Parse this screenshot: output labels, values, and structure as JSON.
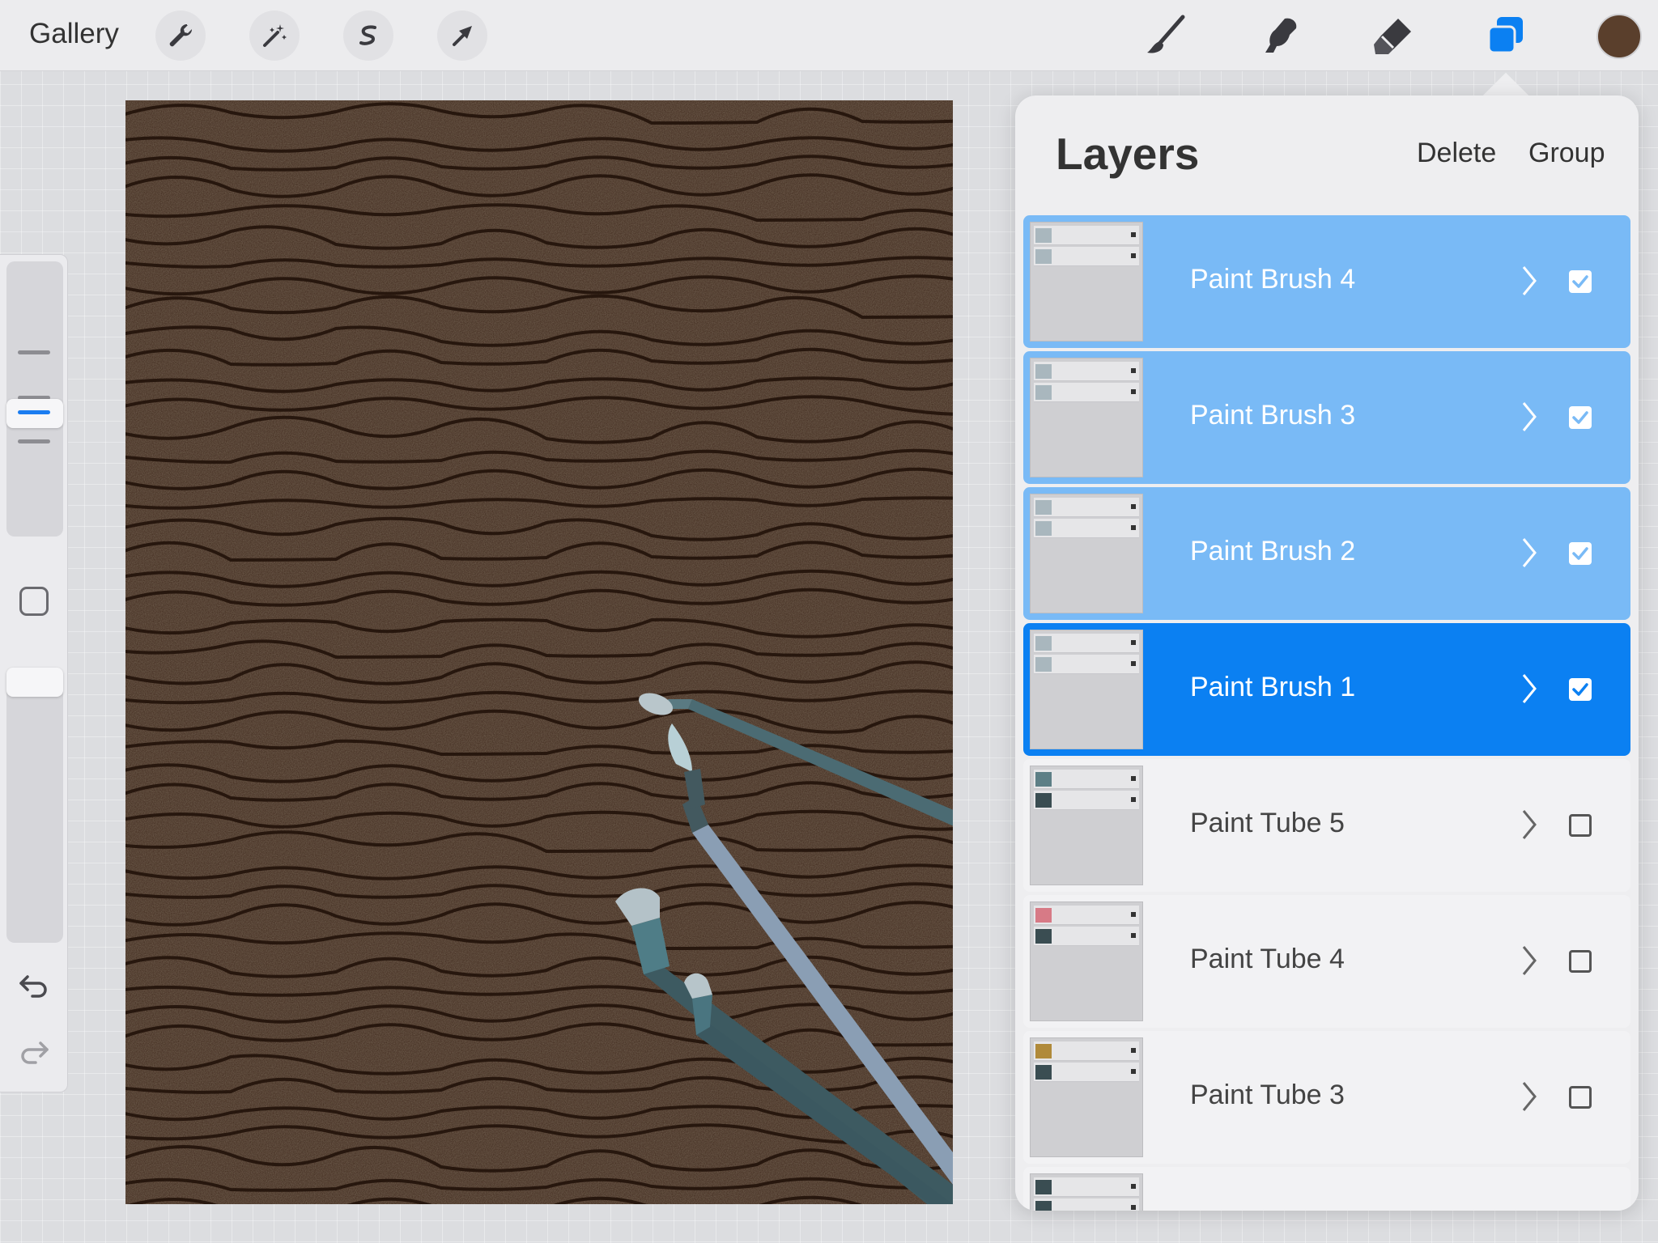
{
  "topbar": {
    "gallery_label": "Gallery",
    "tools": [
      "wrench-icon",
      "magic-wand-icon",
      "selection-icon",
      "transform-arrow-icon"
    ],
    "right_tools": [
      "brush-icon",
      "smudge-icon",
      "eraser-icon",
      "layers-icon"
    ],
    "current_color": "#5a3f2c"
  },
  "sidebar": {
    "brush_size_level": 0.35,
    "opacity_level": 1.0
  },
  "layers_panel": {
    "title": "Layers",
    "delete_label": "Delete",
    "group_label": "Group",
    "layers": [
      {
        "name": "Paint Brush 4",
        "selected": "light",
        "visible": true
      },
      {
        "name": "Paint Brush 3",
        "selected": "light",
        "visible": true
      },
      {
        "name": "Paint Brush 2",
        "selected": "light",
        "visible": true
      },
      {
        "name": "Paint Brush 1",
        "selected": "primary",
        "visible": true
      },
      {
        "name": "Paint Tube 5",
        "selected": "none",
        "visible": false
      },
      {
        "name": "Paint Tube 4",
        "selected": "none",
        "visible": false
      },
      {
        "name": "Paint Tube 3",
        "selected": "none",
        "visible": false
      },
      {
        "name": "",
        "selected": "none",
        "visible": false
      }
    ]
  },
  "colors": {
    "accent": "#0b80f2",
    "accent_light": "#79baf6",
    "canvas_wood": "#3d261a"
  }
}
